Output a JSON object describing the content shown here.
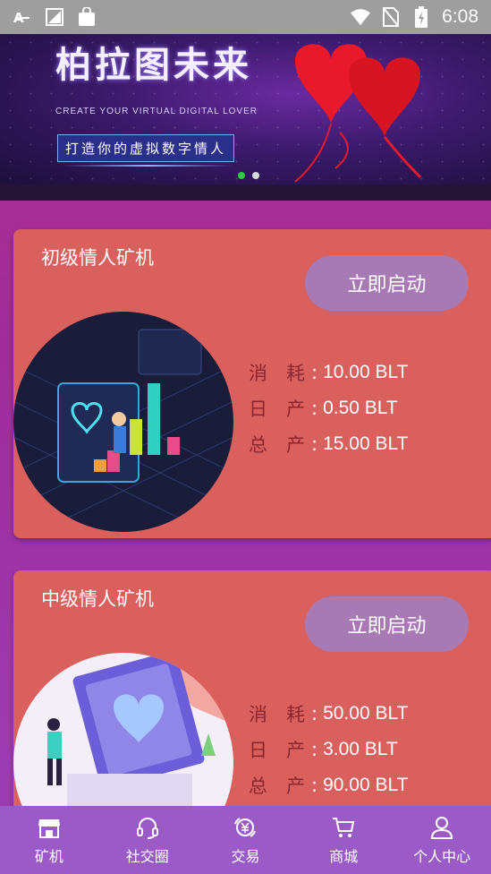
{
  "status_bar": {
    "time": "6:08",
    "icons_left": [
      "a-icon",
      "image-icon",
      "bag-icon"
    ],
    "icons_right": [
      "wifi-icon",
      "sim-icon",
      "battery-icon"
    ]
  },
  "banner": {
    "title": "柏拉图未来",
    "subtitle": "CREATE YOUR VIRTUAL DIGITAL LOVER",
    "slogan": "打造你的虚拟数字情人",
    "slides": 2,
    "active_slide": 1
  },
  "machines": [
    {
      "title": "初级情人矿机",
      "button": "立即启动",
      "consume_label": "消　耗",
      "consume_value": "10.00 BLT",
      "daily_label": "日　产",
      "daily_value": "0.50 BLT",
      "total_label": "总　产",
      "total_value": "15.00 BLT",
      "colon": ":"
    },
    {
      "title": "中级情人矿机",
      "button": "立即启动",
      "consume_label": "消　耗",
      "consume_value": "50.00 BLT",
      "daily_label": "日　产",
      "daily_value": "3.00 BLT",
      "total_label": "总　产",
      "total_value": "90.00 BLT",
      "colon": ":"
    }
  ],
  "nav": [
    {
      "label": "矿机",
      "icon": "store-icon"
    },
    {
      "label": "社交圈",
      "icon": "headset-icon"
    },
    {
      "label": "交易",
      "icon": "yuan-exchange-icon"
    },
    {
      "label": "商城",
      "icon": "cart-icon"
    },
    {
      "label": "个人中心",
      "icon": "user-icon"
    }
  ],
  "colors": {
    "card": "#d9605c",
    "button": "#a87ab4",
    "nav": "#9a5bc7",
    "label": "#8c2630",
    "active_dot": "#2ecc40"
  }
}
